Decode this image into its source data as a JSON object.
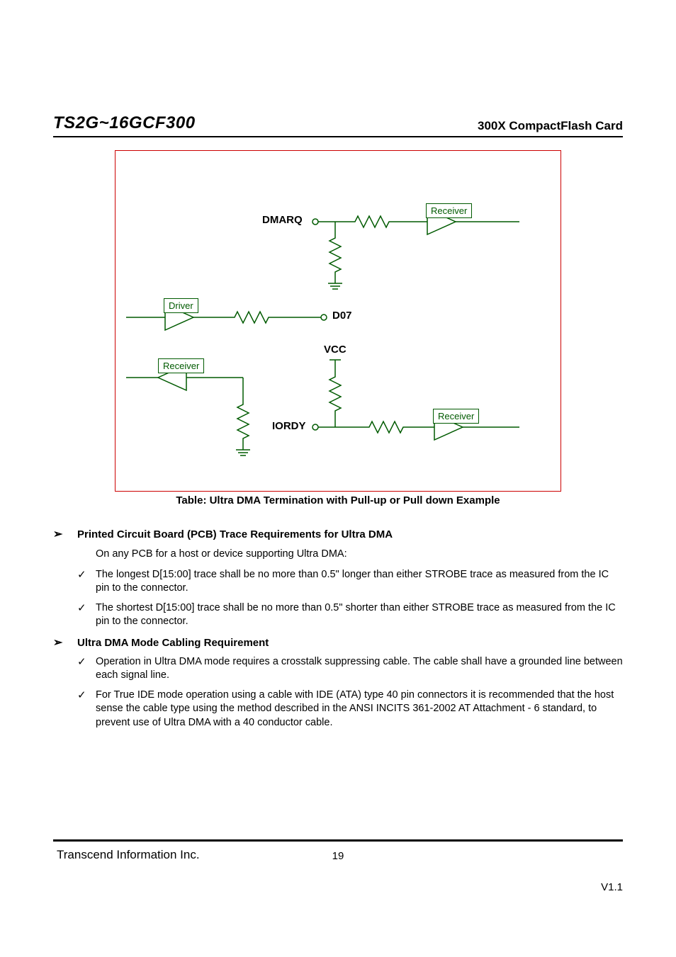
{
  "header": {
    "left": "TS2G~16GCF300",
    "right": "300X CompactFlash Card"
  },
  "figure": {
    "caption": "Table: Ultra DMA Termination with Pull-up or Pull down Example",
    "labels": {
      "dmarq": "DMARQ",
      "d07": "D07",
      "vcc": "VCC",
      "iordy": "IORDY",
      "driver": "Driver",
      "receiver": "Receiver"
    }
  },
  "sections": [
    {
      "heading": "Printed Circuit Board (PCB) Trace Requirements for Ultra DMA",
      "intro": "On any PCB for a host or device supporting Ultra DMA:",
      "items": [
        "The longest D[15:00] trace shall be no more than 0.5\" longer than either STROBE trace as measured from the IC pin to the connector.",
        "The shortest D[15:00] trace shall be no more than 0.5\" shorter than either STROBE trace as measured from the IC pin to the connector."
      ]
    },
    {
      "heading": "Ultra DMA Mode Cabling Requirement",
      "intro": "",
      "items": [
        "Operation in Ultra DMA mode requires a crosstalk suppressing cable. The cable shall have a grounded line between each signal line.",
        "For True IDE mode operation using a cable with IDE (ATA) type 40 pin connectors it is recommended that the host sense the cable type using the method described in the ANSI INCITS 361-2002 AT Attachment - 6 standard, to prevent use of Ultra DMA with a 40 conductor cable."
      ]
    }
  ],
  "footer": {
    "left": "Transcend Information Inc.",
    "page_number": "19",
    "version": "V1.1"
  }
}
